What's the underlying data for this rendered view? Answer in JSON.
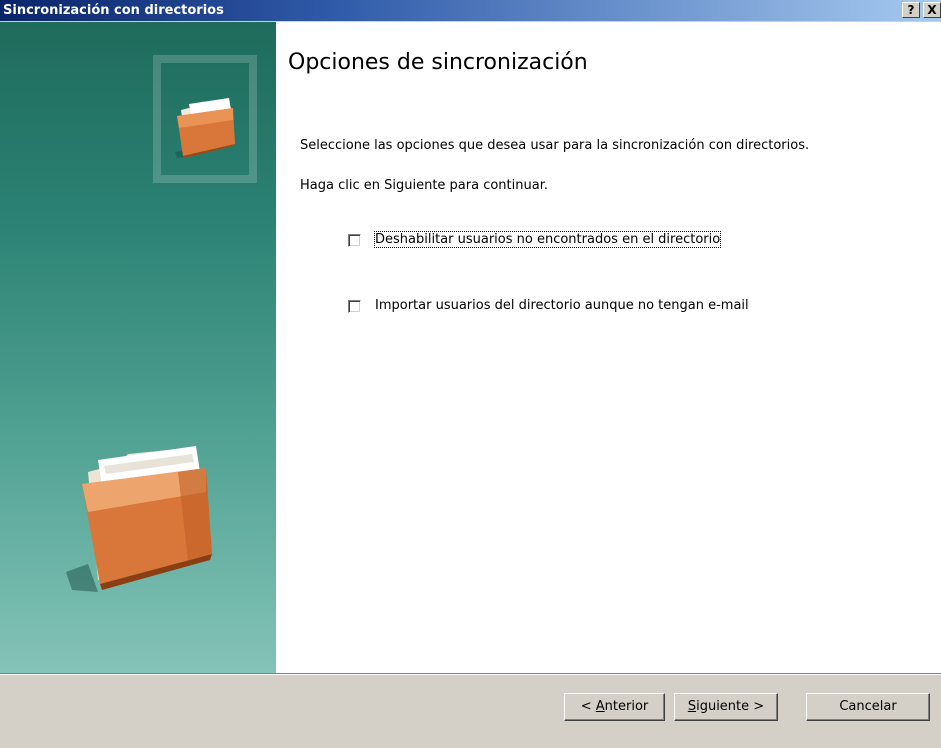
{
  "window": {
    "title": "Sincronización con directorios",
    "help_label": "?",
    "close_label": "X"
  },
  "main": {
    "heading": "Opciones de sincronización",
    "instruction": "Seleccione las opciones que desea usar para la sincronización con directorios.",
    "continue_hint": "Haga clic en Siguiente para continuar.",
    "options": [
      {
        "label": "Deshabilitar usuarios no encontrados en el directorio",
        "checked": false,
        "focused": true
      },
      {
        "label": "Importar usuarios del directorio aunque no tengan e-mail",
        "checked": false,
        "focused": false
      }
    ]
  },
  "sidebar": {
    "icons": [
      "folder-icon-small",
      "folder-icon-large"
    ]
  },
  "footer": {
    "prev_prefix": "< ",
    "prev_key": "A",
    "prev_rest": "nterior",
    "next_key": "S",
    "next_rest": "iguiente >",
    "cancel_label": "Cancelar"
  }
}
